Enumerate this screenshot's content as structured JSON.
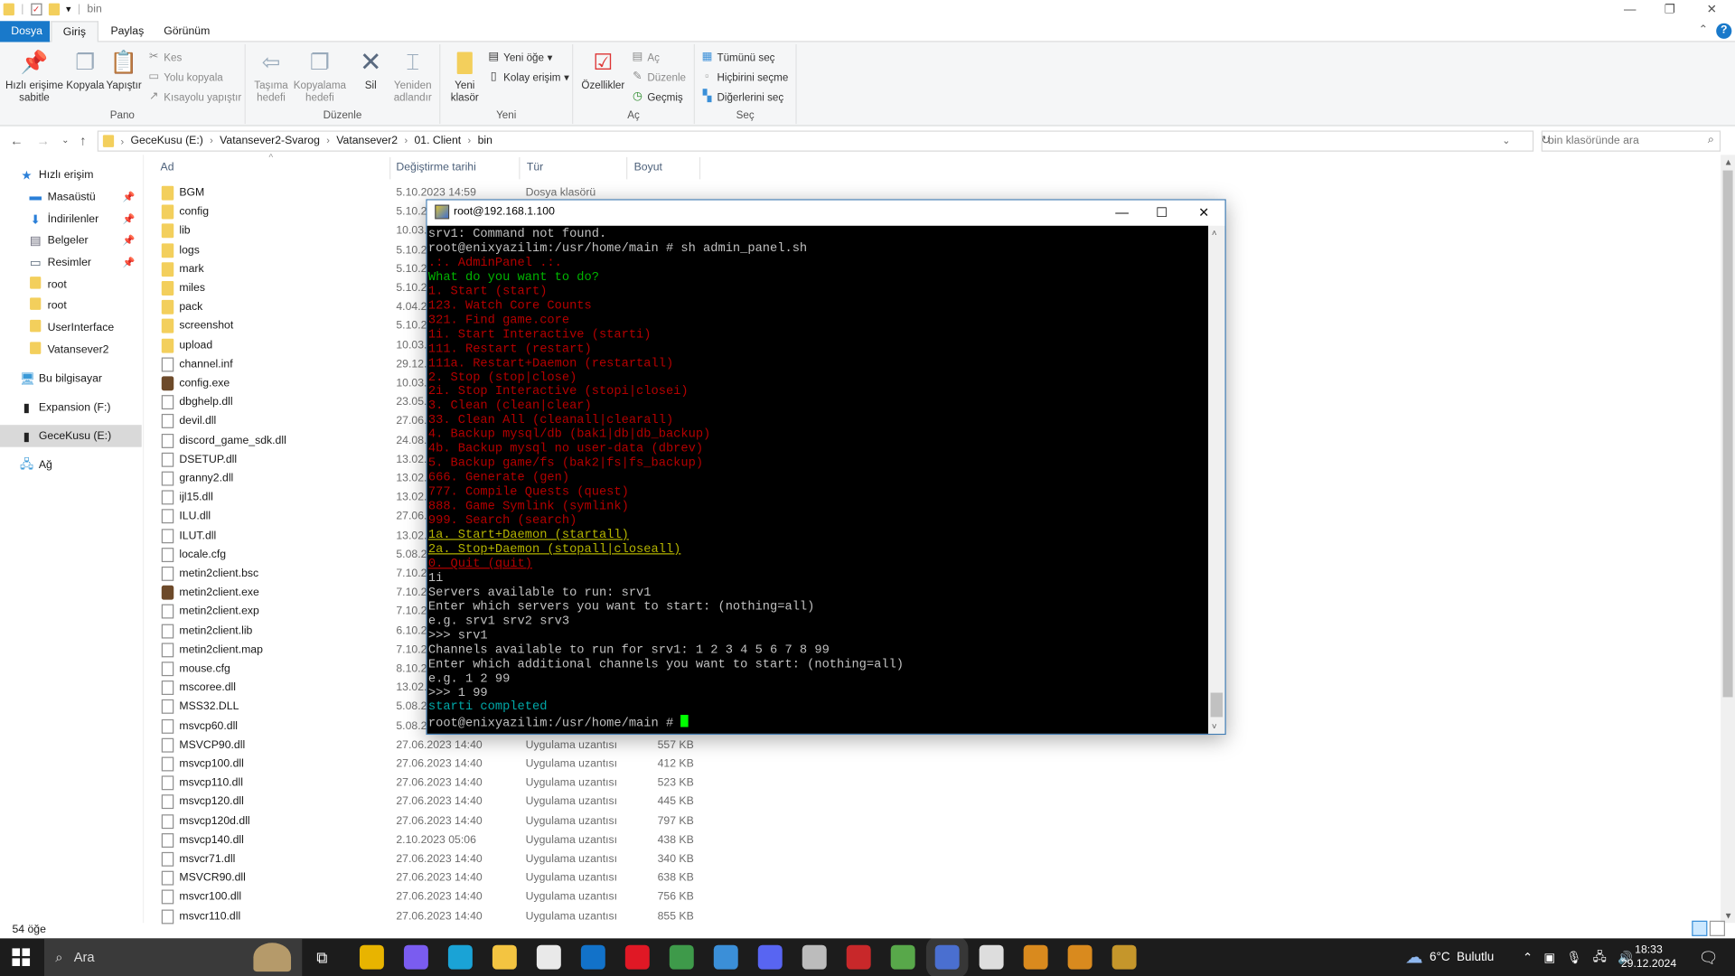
{
  "window": {
    "title": "bin"
  },
  "tabs": [
    {
      "label": "Dosya"
    },
    {
      "label": "Giriş"
    },
    {
      "label": "Paylaş"
    },
    {
      "label": "Görünüm"
    }
  ],
  "ribbon": {
    "pano": {
      "label": "Pano",
      "pin": "Hızlı erişime sabitle",
      "copy": "Kopyala",
      "paste": "Yapıştır",
      "cut": "Kes",
      "copy_path": "Yolu kopyala",
      "paste_shortcut": "Kısayolu yapıştır"
    },
    "duzenle": {
      "label": "Düzenle",
      "move_to": "Taşıma hedefi",
      "copy_to": "Kopyalama hedefi",
      "delete": "Sil",
      "rename": "Yeniden adlandır"
    },
    "yeni": {
      "label": "Yeni",
      "new_folder": "Yeni klasör",
      "new_item": "Yeni öğe",
      "easy_access": "Kolay erişim"
    },
    "ac": {
      "label": "Aç",
      "properties": "Özellikler",
      "open": "Aç",
      "edit": "Düzenle",
      "history": "Geçmiş"
    },
    "sec": {
      "label": "Seç",
      "select_all": "Tümünü seç",
      "select_none": "Hiçbirini seçme",
      "invert": "Diğerlerini seç"
    }
  },
  "address": {
    "breadcrumbs": [
      "GeceKusu (E:)",
      "Vatansever2-Svarog",
      "Vatansever2",
      "01. Client",
      "bin"
    ],
    "search_placeholder": "bin klasöründe ara"
  },
  "nav": [
    {
      "label": "Hızlı erişim",
      "icon": "star-icon"
    },
    {
      "label": "Masaüstü",
      "icon": "desktop-icon",
      "pinned": true
    },
    {
      "label": "İndirilenler",
      "icon": "download-icon",
      "pinned": true
    },
    {
      "label": "Belgeler",
      "icon": "documents-icon",
      "pinned": true
    },
    {
      "label": "Resimler",
      "icon": "pictures-icon",
      "pinned": true
    },
    {
      "label": "root",
      "icon": "folder-icon"
    },
    {
      "label": "root",
      "icon": "folder-icon"
    },
    {
      "label": "UserInterface",
      "icon": "folder-icon"
    },
    {
      "label": "Vatansever2",
      "icon": "folder-icon"
    },
    {
      "label": "Bu bilgisayar",
      "icon": "computer-icon"
    },
    {
      "label": "Expansion (F:)",
      "icon": "drive-icon"
    },
    {
      "label": "GeceKusu (E:)",
      "icon": "drive-icon",
      "selected": true
    },
    {
      "label": "Ağ",
      "icon": "network-icon"
    }
  ],
  "columns": {
    "name": "Ad",
    "date": "Değiştirme tarihi",
    "type": "Tür",
    "size": "Boyut"
  },
  "files": [
    {
      "name": "BGM",
      "kind": "folder",
      "date": "5.10.2023 14:59",
      "type": "Dosya klasörü"
    },
    {
      "name": "config",
      "kind": "folder",
      "date": "5.10.20"
    },
    {
      "name": "lib",
      "kind": "folder",
      "date": "10.03.2"
    },
    {
      "name": "logs",
      "kind": "folder",
      "date": "5.10.20"
    },
    {
      "name": "mark",
      "kind": "folder",
      "date": "5.10.20"
    },
    {
      "name": "miles",
      "kind": "folder",
      "date": "5.10.20"
    },
    {
      "name": "pack",
      "kind": "folder",
      "date": "4.04.20"
    },
    {
      "name": "screenshot",
      "kind": "folder",
      "date": "5.10.20"
    },
    {
      "name": "upload",
      "kind": "folder",
      "date": "10.03.2"
    },
    {
      "name": "channel.inf",
      "kind": "file",
      "date": "29.12.2"
    },
    {
      "name": "config.exe",
      "kind": "exe",
      "date": "10.03.2"
    },
    {
      "name": "dbghelp.dll",
      "kind": "file",
      "date": "23.05.2"
    },
    {
      "name": "devil.dll",
      "kind": "file",
      "date": "27.06.2"
    },
    {
      "name": "discord_game_sdk.dll",
      "kind": "file",
      "date": "24.08.2"
    },
    {
      "name": "DSETUP.dll",
      "kind": "file",
      "date": "13.02.2"
    },
    {
      "name": "granny2.dll",
      "kind": "file",
      "date": "13.02.2"
    },
    {
      "name": "ijl15.dll",
      "kind": "file",
      "date": "13.02.2"
    },
    {
      "name": "ILU.dll",
      "kind": "file",
      "date": "27.06.2"
    },
    {
      "name": "ILUT.dll",
      "kind": "file",
      "date": "13.02.2"
    },
    {
      "name": "locale.cfg",
      "kind": "file",
      "date": "5.08.20"
    },
    {
      "name": "metin2client.bsc",
      "kind": "file",
      "date": "7.10.20"
    },
    {
      "name": "metin2client.exe",
      "kind": "exe",
      "date": "7.10.20"
    },
    {
      "name": "metin2client.exp",
      "kind": "file",
      "date": "7.10.20"
    },
    {
      "name": "metin2client.lib",
      "kind": "file",
      "date": "6.10.20"
    },
    {
      "name": "metin2client.map",
      "kind": "file",
      "date": "7.10.20"
    },
    {
      "name": "mouse.cfg",
      "kind": "file",
      "date": "8.10.20"
    },
    {
      "name": "mscoree.dll",
      "kind": "file",
      "date": "13.02.2"
    },
    {
      "name": "MSS32.DLL",
      "kind": "file",
      "date": "5.08.20"
    },
    {
      "name": "msvcp60.dll",
      "kind": "file",
      "date": "5.08.20"
    },
    {
      "name": "MSVCP90.dll",
      "kind": "file",
      "date": "27.06.2023 14:40",
      "type": "Uygulama uzantısı",
      "size": "557 KB"
    },
    {
      "name": "msvcp100.dll",
      "kind": "file",
      "date": "27.06.2023 14:40",
      "type": "Uygulama uzantısı",
      "size": "412 KB"
    },
    {
      "name": "msvcp110.dll",
      "kind": "file",
      "date": "27.06.2023 14:40",
      "type": "Uygulama uzantısı",
      "size": "523 KB"
    },
    {
      "name": "msvcp120.dll",
      "kind": "file",
      "date": "27.06.2023 14:40",
      "type": "Uygulama uzantısı",
      "size": "445 KB"
    },
    {
      "name": "msvcp120d.dll",
      "kind": "file",
      "date": "27.06.2023 14:40",
      "type": "Uygulama uzantısı",
      "size": "797 KB"
    },
    {
      "name": "msvcp140.dll",
      "kind": "file",
      "date": "2.10.2023 05:06",
      "type": "Uygulama uzantısı",
      "size": "438 KB"
    },
    {
      "name": "msvcr71.dll",
      "kind": "file",
      "date": "27.06.2023 14:40",
      "type": "Uygulama uzantısı",
      "size": "340 KB"
    },
    {
      "name": "MSVCR90.dll",
      "kind": "file",
      "date": "27.06.2023 14:40",
      "type": "Uygulama uzantısı",
      "size": "638 KB"
    },
    {
      "name": "msvcr100.dll",
      "kind": "file",
      "date": "27.06.2023 14:40",
      "type": "Uygulama uzantısı",
      "size": "756 KB"
    },
    {
      "name": "msvcr110.dll",
      "kind": "file",
      "date": "27.06.2023 14:40",
      "type": "Uygulama uzantısı",
      "size": "855 KB"
    }
  ],
  "status": {
    "count": "54 öğe"
  },
  "terminal": {
    "title": "root@192.168.1.100",
    "colors": {
      "default": "#c0c0c0",
      "red": "#b40000",
      "green": "#00b400",
      "yellow": "#b4b400",
      "cyan": "#00a8a8",
      "cursor": "#00ff00"
    },
    "lines": [
      {
        "text": "srv1: Command not found.",
        "color": "default"
      },
      {
        "text": "root@enixyazilim:/usr/home/main # sh admin_panel.sh",
        "color": "default"
      },
      {
        "text": ".:. AdminPanel .:.",
        "color": "red"
      },
      {
        "text": "What do you want to do?",
        "color": "green"
      },
      {
        "text": "1. Start (start)",
        "color": "red"
      },
      {
        "text": "123. Watch Core Counts",
        "color": "red"
      },
      {
        "text": "321. Find game.core",
        "color": "red"
      },
      {
        "text": "1i. Start Interactive (starti)",
        "color": "red"
      },
      {
        "text": "111. Restart (restart)",
        "color": "red"
      },
      {
        "text": "111a. Restart+Daemon (restartall)",
        "color": "red"
      },
      {
        "text": "2. Stop (stop|close)",
        "color": "red"
      },
      {
        "text": "2i. Stop Interactive (stopi|closei)",
        "color": "red"
      },
      {
        "text": "3. Clean (clean|clear)",
        "color": "red"
      },
      {
        "text": "33. Clean All (cleanall|clearall)",
        "color": "red"
      },
      {
        "text": "4. Backup mysql/db (bak1|db|db_backup)",
        "color": "red"
      },
      {
        "text": "4b. Backup mysql no user-data (dbrev)",
        "color": "red"
      },
      {
        "text": "5. Backup game/fs (bak2|fs|fs_backup)",
        "color": "red"
      },
      {
        "text": "666. Generate (gen)",
        "color": "red"
      },
      {
        "text": "777. Compile Quests (quest)",
        "color": "red"
      },
      {
        "text": "888. Game Symlink (symlink)",
        "color": "red"
      },
      {
        "text": "999. Search (search)",
        "color": "red"
      },
      {
        "text": "1a. Start+Daemon (startall)",
        "color": "yellow"
      },
      {
        "text": "2a. Stop+Daemon (stopall|closeall)",
        "color": "yellow"
      },
      {
        "text": "0. Quit (quit)",
        "color": "redu"
      },
      {
        "text": "1i",
        "color": "default"
      },
      {
        "text": "Servers available to run: srv1",
        "color": "default"
      },
      {
        "text": "Enter which servers you want to start: (nothing=all)",
        "color": "default"
      },
      {
        "text": "e.g. srv1 srv2 srv3",
        "color": "default"
      },
      {
        "text": ">>> srv1",
        "color": "default"
      },
      {
        "text": "Channels available to run for srv1: 1 2 3 4 5 6 7 8 99",
        "color": "default"
      },
      {
        "text": "Enter which additional channels you want to start: (nothing=all)",
        "color": "default"
      },
      {
        "text": "e.g. 1 2 99",
        "color": "default"
      },
      {
        "text": ">>> 1 99",
        "color": "default"
      },
      {
        "text": "starti completed",
        "color": "cyan"
      },
      {
        "text": "root@enixyazilim:/usr/home/main # ",
        "color": "default",
        "cursor": true
      }
    ]
  },
  "taskbar": {
    "search_label": "Ara",
    "apps": [
      {
        "icon": "chrome-canary-icon",
        "color": "#e8b400"
      },
      {
        "icon": "copilot-icon",
        "color": "#7a5cf0"
      },
      {
        "icon": "edge-icon",
        "color": "#1aa3d6"
      },
      {
        "icon": "file-explorer-icon",
        "color": "#f3c441"
      },
      {
        "icon": "store-icon",
        "color": "#e9e9e9"
      },
      {
        "icon": "outlook-icon",
        "color": "#1272c9"
      },
      {
        "icon": "opera-icon",
        "color": "#e01825"
      },
      {
        "icon": "chrome-icon",
        "color": "#3e9a4a"
      },
      {
        "icon": "settings-app-icon",
        "color": "#3b8fd8"
      },
      {
        "icon": "discord-icon",
        "color": "#5865f2"
      },
      {
        "icon": "virtualbox-icon",
        "color": "#bcbcbc"
      },
      {
        "icon": "filezilla-icon",
        "color": "#c8282a"
      },
      {
        "icon": "winscp-icon",
        "color": "#58a84a"
      },
      {
        "icon": "putty-icon",
        "color": "#4a6fd0"
      },
      {
        "icon": "rockstar-icon",
        "color": "#dddddd"
      },
      {
        "icon": "metin2-icon",
        "color": "#d98a1e"
      },
      {
        "icon": "metin2-icon-2",
        "color": "#d98a1e"
      },
      {
        "icon": "game-h-icon",
        "color": "#c5962b"
      }
    ],
    "weather": {
      "temp": "6°C",
      "condition": "Bulutlu"
    },
    "time": "18:33",
    "date": "29.12.2024"
  }
}
